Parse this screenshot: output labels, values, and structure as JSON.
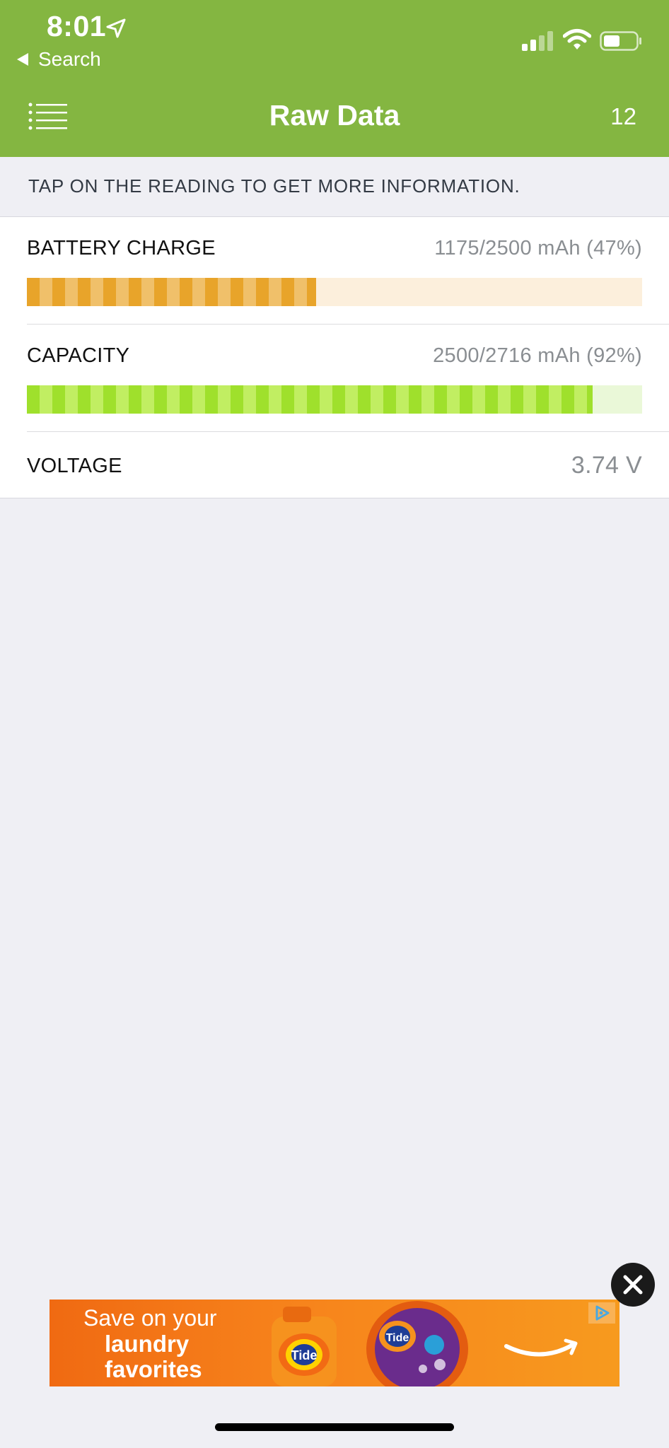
{
  "status_bar": {
    "time": "8:01",
    "back_label": "Search"
  },
  "header": {
    "title": "Raw Data",
    "count": "12"
  },
  "instruction": "TAP ON THE READING TO GET MORE INFORMATION.",
  "readings": {
    "battery_charge": {
      "label": "BATTERY CHARGE",
      "value": "1175/2500 mAh (47%)",
      "fraction": 0.47
    },
    "capacity": {
      "label": "CAPACITY",
      "value": "2500/2716 mAh (92%)",
      "fraction": 0.92
    },
    "voltage": {
      "label": "VOLTAGE",
      "value": "3.74 V"
    }
  },
  "ad": {
    "line1": "Save on your",
    "line2": "laundry",
    "line3": "favorites",
    "brand": "Tide"
  },
  "colors": {
    "header_green": "#84b641",
    "charge_orange": "#e8a42a",
    "capacity_green": "#9fe02c",
    "ad_orange": "#f07a18"
  }
}
